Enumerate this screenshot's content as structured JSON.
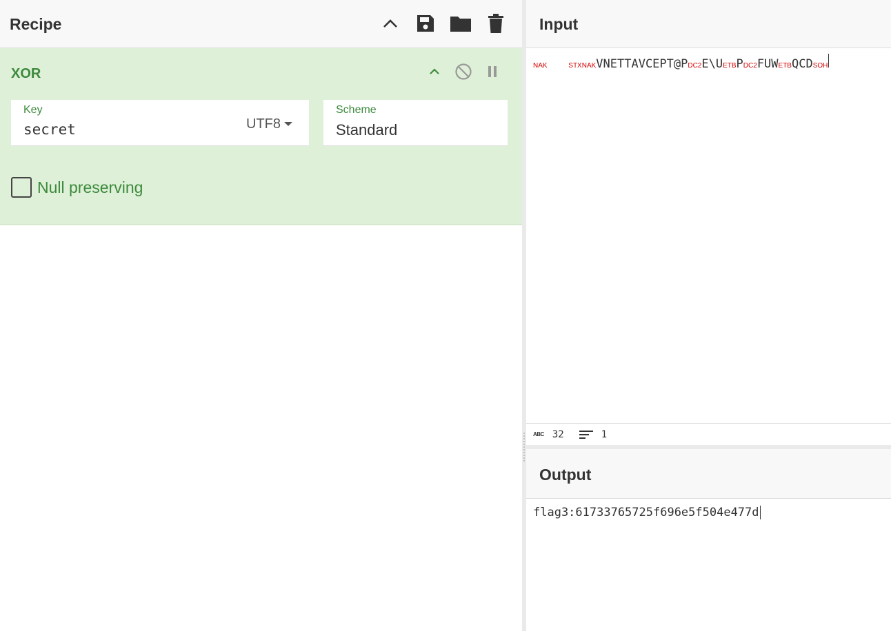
{
  "recipe": {
    "title": "Recipe",
    "header_icons": [
      "chevron-up-icon",
      "save-icon",
      "folder-icon",
      "trash-icon"
    ],
    "operation": {
      "name": "XOR",
      "icons": [
        "chevron-up-icon",
        "disable-icon",
        "pause-icon"
      ],
      "key": {
        "label": "Key",
        "value": "secret",
        "encoding": "UTF8"
      },
      "scheme": {
        "label": "Scheme",
        "value": "Standard"
      },
      "null_preserving": {
        "label": "Null preserving",
        "checked": false
      }
    }
  },
  "input": {
    "title": "Input",
    "segments": [
      {
        "t": "NAK",
        "cc": true
      },
      {
        "t": "   ",
        "cc": false
      },
      {
        "t": "STX",
        "cc": true
      },
      {
        "t": "NAK",
        "cc": true
      },
      {
        "t": "VNETTAVCEPT@P",
        "cc": false
      },
      {
        "t": "DC2",
        "cc": true
      },
      {
        "t": "E\\U",
        "cc": false
      },
      {
        "t": "ETB",
        "cc": true
      },
      {
        "t": "P",
        "cc": false
      },
      {
        "t": "DC2",
        "cc": true
      },
      {
        "t": "FUW",
        "cc": false
      },
      {
        "t": "ETB",
        "cc": true
      },
      {
        "t": "QCD",
        "cc": false
      },
      {
        "t": "SOH",
        "cc": true
      }
    ],
    "status": {
      "length_icon": "abc-icon",
      "length": "32",
      "lines_icon": "lines-icon",
      "lines": "1"
    }
  },
  "output": {
    "title": "Output",
    "text": "flag3:61733765725f696e5f504e477d"
  },
  "colors": {
    "op_bg": "#dff0d8",
    "op_green": "#3c8a3c",
    "control_char": "#d40000"
  }
}
